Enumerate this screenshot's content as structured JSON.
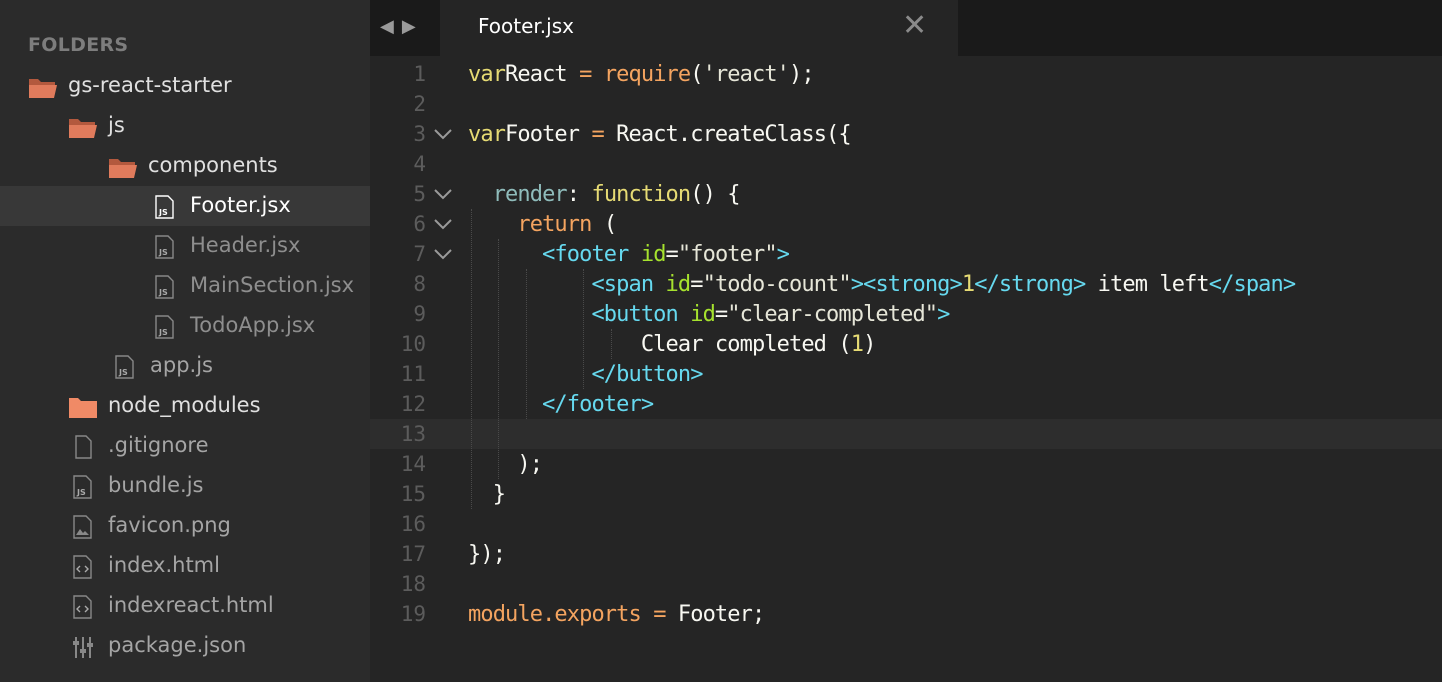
{
  "sidebar": {
    "header": "FOLDERS",
    "items": [
      {
        "label": "gs-react-starter",
        "type": "folder-open"
      },
      {
        "label": "js",
        "type": "folder-open"
      },
      {
        "label": "components",
        "type": "folder-open"
      },
      {
        "label": "Footer.jsx",
        "type": "js-file",
        "selected": true
      },
      {
        "label": "Header.jsx",
        "type": "js-file"
      },
      {
        "label": "MainSection.jsx",
        "type": "js-file"
      },
      {
        "label": "TodoApp.jsx",
        "type": "js-file"
      },
      {
        "label": "app.js",
        "type": "js-file"
      },
      {
        "label": "node_modules",
        "type": "folder-closed"
      },
      {
        "label": ".gitignore",
        "type": "file"
      },
      {
        "label": "bundle.js",
        "type": "js-file"
      },
      {
        "label": "favicon.png",
        "type": "image-file"
      },
      {
        "label": "index.html",
        "type": "html-file"
      },
      {
        "label": "indexreact.html",
        "type": "html-file"
      },
      {
        "label": "package.json",
        "type": "json-file"
      }
    ]
  },
  "tabbar": {
    "nav_back": "◀",
    "nav_forward": "▶",
    "active_tab": "Footer.jsx",
    "close_glyph": "✕"
  },
  "editor": {
    "line_numbers": [
      "1",
      "2",
      "3",
      "4",
      "5",
      "6",
      "7",
      "8",
      "9",
      "10",
      "11",
      "12",
      "13",
      "14",
      "15",
      "16",
      "17",
      "18",
      "19"
    ],
    "current_line": 13,
    "lines": [
      [
        [
          "kw",
          "var"
        ],
        [
          "",
          "React"
        ],
        [
          "op",
          " = "
        ],
        [
          "kwo",
          "require"
        ],
        [
          "",
          "("
        ],
        [
          "str",
          "'react'"
        ],
        [
          "",
          ");"
        ]
      ],
      [],
      [
        [
          "kw",
          "var"
        ],
        [
          "",
          "Footer"
        ],
        [
          "op",
          " = "
        ],
        [
          "",
          "React.createClass({"
        ]
      ],
      [],
      [
        [
          "",
          "  "
        ],
        [
          "prop",
          "render"
        ],
        [
          "",
          ":"
        ],
        [
          "fn",
          " function"
        ],
        [
          "",
          "() {"
        ]
      ],
      [
        [
          "",
          "    "
        ],
        [
          "kwo",
          "return"
        ],
        [
          "",
          " ("
        ]
      ],
      [
        [
          "",
          "      "
        ],
        [
          "tagc",
          "<footer"
        ],
        [
          "attr",
          " id"
        ],
        [
          "",
          "="
        ],
        [
          "str",
          "\"footer\""
        ],
        [
          "tagc",
          ">"
        ]
      ],
      [
        [
          "",
          "          "
        ],
        [
          "tagc",
          "<span"
        ],
        [
          "attr",
          " id"
        ],
        [
          "",
          "="
        ],
        [
          "str",
          "\"todo-count\""
        ],
        [
          "tagc",
          "><strong>"
        ],
        [
          "num",
          "1"
        ],
        [
          "tagc",
          "</strong>"
        ],
        [
          "",
          " item left"
        ],
        [
          "tagc",
          "</span>"
        ]
      ],
      [
        [
          "",
          "          "
        ],
        [
          "tagc",
          "<button"
        ],
        [
          "attr",
          " id"
        ],
        [
          "",
          "="
        ],
        [
          "str",
          "\"clear-completed\""
        ],
        [
          "tagc",
          ">"
        ]
      ],
      [
        [
          "",
          "              Clear completed ("
        ],
        [
          "num",
          "1"
        ],
        [
          "",
          ")"
        ]
      ],
      [
        [
          "",
          "          "
        ],
        [
          "tagc",
          "</button>"
        ]
      ],
      [
        [
          "",
          "      "
        ],
        [
          "tagc",
          "</footer>"
        ]
      ],
      [],
      [
        [
          "",
          "    );"
        ]
      ],
      [
        [
          "",
          "  }"
        ]
      ],
      [],
      [
        [
          "",
          "});"
        ]
      ],
      [],
      [
        [
          "kwo",
          "module.exports"
        ],
        [
          "op",
          " = "
        ],
        [
          "",
          "Footer;"
        ]
      ]
    ],
    "folds": [
      3,
      5,
      6,
      7
    ]
  },
  "colors": {
    "sidebar_bg": "#2b2b2b",
    "editor_bg": "#252525",
    "folder_orange": "#e07b5c",
    "keyword_yellow": "#e6db74",
    "keyword_orange": "#f4a460",
    "tag_cyan": "#66d9ef",
    "attr_green": "#a6e22e"
  }
}
